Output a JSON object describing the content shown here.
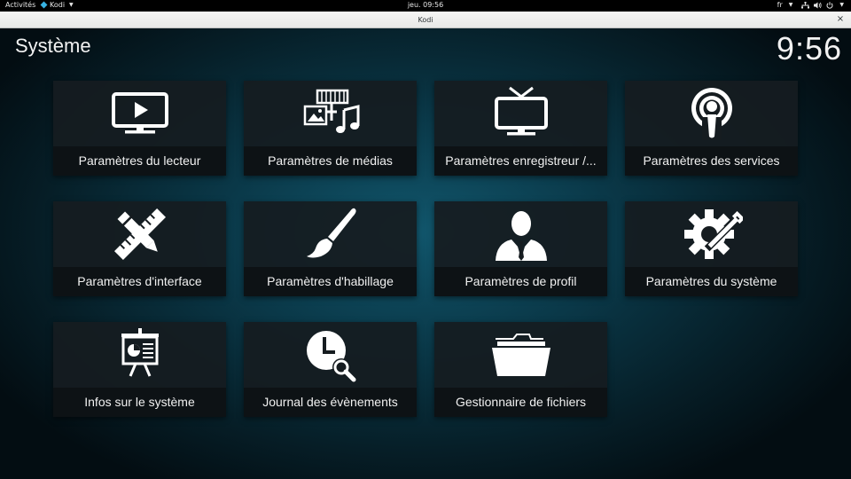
{
  "topbar": {
    "activities": "Activités",
    "app_name": "Kodi",
    "clock": "jeu. 09:56",
    "language": "fr"
  },
  "window": {
    "title": "Kodi",
    "close_glyph": "×"
  },
  "kodi": {
    "page_title": "Système",
    "clock": "9:56",
    "tiles": [
      {
        "label": "Paramètres du lecteur",
        "icon": "tv-play-icon"
      },
      {
        "label": "Paramètres de médias",
        "icon": "media-icon"
      },
      {
        "label": "Paramètres enregistreur /...",
        "icon": "tv-antenna-icon"
      },
      {
        "label": "Paramètres des services",
        "icon": "podcast-icon"
      },
      {
        "label": "Paramètres d'interface",
        "icon": "pencil-ruler-icon"
      },
      {
        "label": "Paramètres d'habillage",
        "icon": "paintbrush-icon"
      },
      {
        "label": "Paramètres de profil",
        "icon": "user-icon"
      },
      {
        "label": "Paramètres du système",
        "icon": "gear-wrench-icon"
      },
      {
        "label": "Infos sur le système",
        "icon": "presentation-icon"
      },
      {
        "label": "Journal des évènements",
        "icon": "clock-search-icon"
      },
      {
        "label": "Gestionnaire de fichiers",
        "icon": "folder-icon"
      }
    ]
  }
}
